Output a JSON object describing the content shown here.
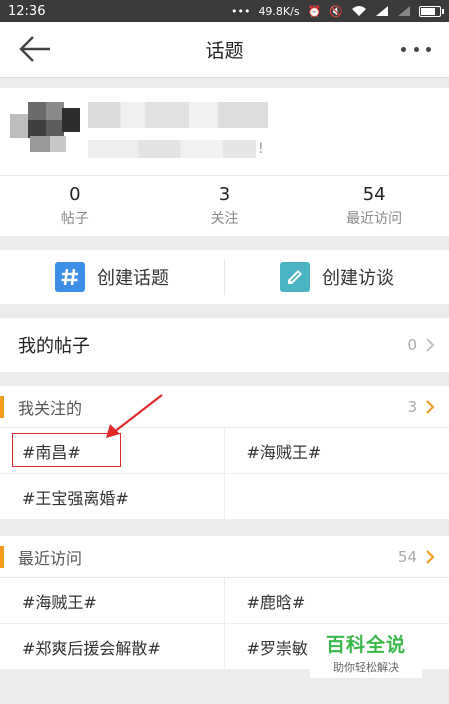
{
  "status_bar": {
    "time": "12:36",
    "speed": "49.8K/s"
  },
  "nav": {
    "title": "话题"
  },
  "profile": {
    "signature_tail": "!",
    "stats": [
      {
        "value": "0",
        "label": "帖子"
      },
      {
        "value": "3",
        "label": "关注"
      },
      {
        "value": "54",
        "label": "最近访问"
      }
    ]
  },
  "actions": {
    "create_topic": "创建话题",
    "create_interview": "创建访谈"
  },
  "my_posts": {
    "label": "我的帖子",
    "count": "0"
  },
  "following": {
    "label": "我关注的",
    "count": "3",
    "items": [
      "#南昌#",
      "#海贼王#",
      "#王宝强离婚#"
    ]
  },
  "recent": {
    "label": "最近访问",
    "count": "54",
    "items": [
      "#海贼王#",
      "#鹿晗#",
      "#郑爽后援会解散#",
      "#罗崇敏"
    ]
  },
  "watermark": {
    "title": "百科全说",
    "subtitle": "助你轻松解决"
  },
  "colors": {
    "accent_orange": "#f39b1f",
    "annotation_red": "#e02a2a",
    "topic_icon_blue": "#3d8ee6",
    "interview_icon_teal": "#4bb3c4",
    "watermark_green": "#3cb84a"
  },
  "icons": {
    "back": "arrow-left-icon",
    "more": "more-dots-icon",
    "topic": "hash-icon",
    "interview": "pen-icon",
    "chevron": "chevron-right-icon"
  }
}
